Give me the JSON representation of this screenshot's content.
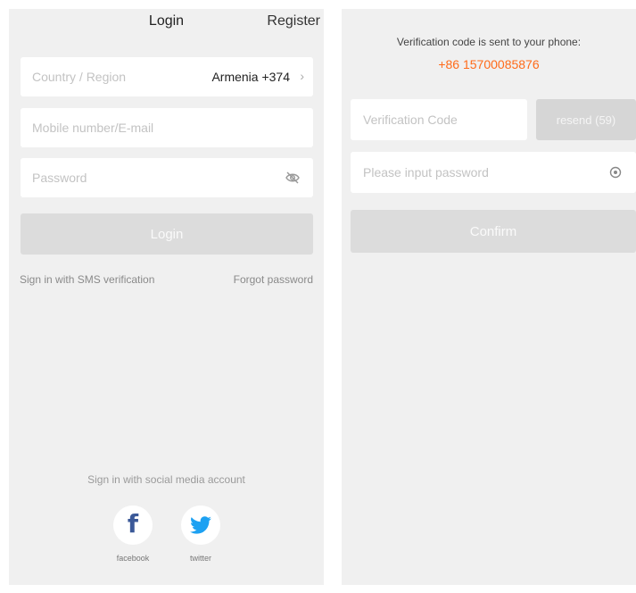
{
  "login_screen": {
    "header": {
      "title": "Login",
      "register": "Register"
    },
    "country": {
      "label": "Country / Region",
      "value": "Armenia +374",
      "chevron": "›"
    },
    "mobile": {
      "placeholder": "Mobile number/E-mail"
    },
    "password": {
      "placeholder": "Password",
      "icon": "eye-off-icon"
    },
    "login_button": "Login",
    "sms_link": "Sign in with SMS verification",
    "forgot_link": "Forgot password",
    "social": {
      "title": "Sign in with social media account",
      "facebook": {
        "label": "facebook",
        "color": "#3b5998"
      },
      "twitter": {
        "label": "twitter",
        "color": "#1da1f2"
      }
    }
  },
  "verify_screen": {
    "message": "Verification code is sent to your phone:",
    "phone": "+86 15700085876",
    "phone_color": "#ff6b1a",
    "code_placeholder": "Verification Code",
    "resend_label": "resend (59)",
    "password_placeholder": "Please input password",
    "confirm_label": "Confirm"
  }
}
